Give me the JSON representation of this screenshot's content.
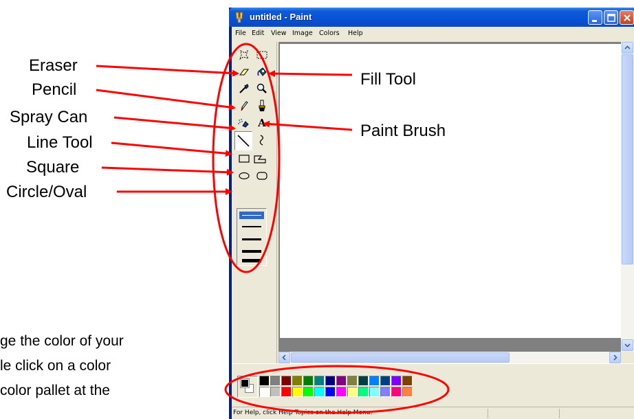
{
  "window": {
    "title": "untitled - Paint"
  },
  "menu": [
    "File",
    "Edit",
    "View",
    "Image",
    "Colors",
    "Help"
  ],
  "tools": [
    {
      "name": "free-form-select",
      "selected": false
    },
    {
      "name": "select",
      "selected": false
    },
    {
      "name": "eraser",
      "selected": false
    },
    {
      "name": "fill",
      "selected": false
    },
    {
      "name": "pick-color",
      "selected": false
    },
    {
      "name": "magnifier",
      "selected": false
    },
    {
      "name": "pencil",
      "selected": false
    },
    {
      "name": "brush",
      "selected": false
    },
    {
      "name": "airbrush",
      "selected": false
    },
    {
      "name": "text",
      "selected": false
    },
    {
      "name": "line",
      "selected": true
    },
    {
      "name": "curve",
      "selected": false
    },
    {
      "name": "rectangle",
      "selected": false
    },
    {
      "name": "polygon",
      "selected": false
    },
    {
      "name": "ellipse",
      "selected": false
    },
    {
      "name": "rounded-rectangle",
      "selected": false
    }
  ],
  "text_tool_glyph": "A",
  "colors": {
    "foreground": "#000000",
    "background": "#ffffff",
    "palette_top": [
      "#000000",
      "#808080",
      "#800000",
      "#808000",
      "#008000",
      "#008080",
      "#000080",
      "#800080",
      "#808040",
      "#004040",
      "#0080ff",
      "#004080",
      "#8000ff",
      "#804000"
    ],
    "palette_bottom": [
      "#ffffff",
      "#c0c0c0",
      "#ff0000",
      "#ffff00",
      "#00ff00",
      "#00ffff",
      "#0000ff",
      "#ff00ff",
      "#ffff80",
      "#00ff80",
      "#80ffff",
      "#8080ff",
      "#ff0080",
      "#ff8040"
    ],
    "annotation": "#ff0000",
    "title_bar": "#0852d6"
  },
  "status": {
    "text": "For Help, click Help Topics on the Help Menu."
  },
  "callouts": {
    "eraser": "Eraser",
    "pencil": "Pencil",
    "spray_can": "Spray Can",
    "line_tool": "Line Tool",
    "square": "Square",
    "circle_oval": "Circle/Oval",
    "fill_tool": "Fill Tool",
    "paint_brush": "Paint Brush"
  },
  "note": {
    "line1": "ge the color of your",
    "line2": "le click on a color",
    "line3": "color pallet at the"
  }
}
